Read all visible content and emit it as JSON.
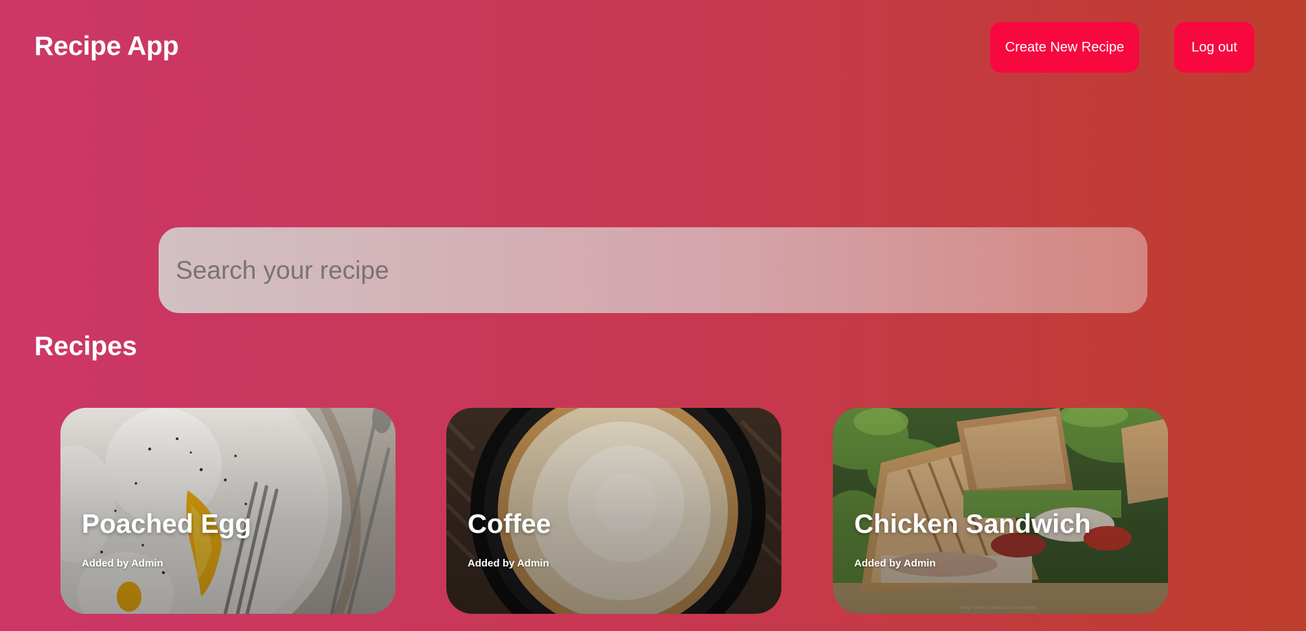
{
  "header": {
    "app_title": "Recipe App",
    "create_button_label": "Create New Recipe",
    "logout_button_label": "Log out"
  },
  "search": {
    "placeholder": "Search your recipe",
    "value": ""
  },
  "recipes_section": {
    "title": "Recipes",
    "items": [
      {
        "title": "Poached Egg",
        "author": "Added by Admin",
        "image": "poached-egg-photo"
      },
      {
        "title": "Coffee",
        "author": "Added by Admin",
        "image": "coffee-cup-photo"
      },
      {
        "title": "Chicken Sandwich",
        "author": "Added by Admin",
        "image": "chicken-sandwich-photo"
      }
    ]
  },
  "colors": {
    "background_start": "#cc3768",
    "background_end": "#be3e2c",
    "button": "#f7083f",
    "text": "#ffffff"
  }
}
